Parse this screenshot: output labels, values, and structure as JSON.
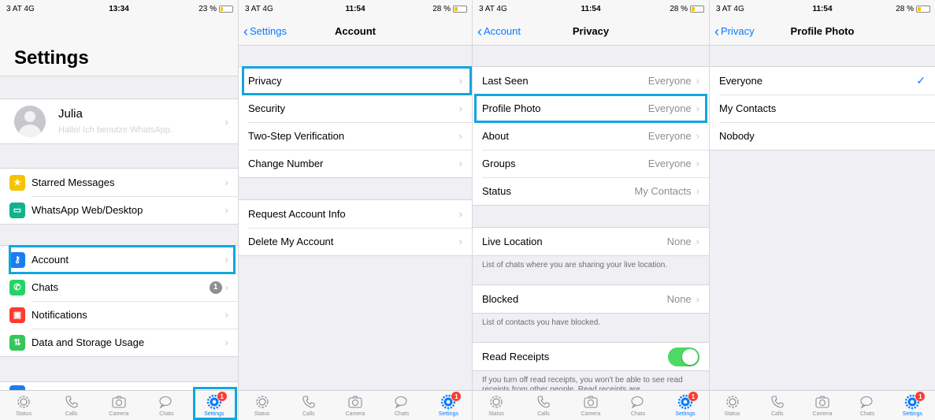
{
  "status": {
    "left": {
      "carrier": "3 AT 4G",
      "time": "13:34",
      "battery": "23 %",
      "battery_level": 0.23
    },
    "other": {
      "carrier": "3 AT 4G",
      "time": "11:54",
      "battery": "28 %",
      "battery_level": 0.28
    }
  },
  "tabs": [
    "Status",
    "Calls",
    "Camera",
    "Chats",
    "Settings"
  ],
  "tab_badge": "1",
  "settings": {
    "title": "Settings",
    "profile_name": "Julia",
    "profile_about": "Hallo! Ich benutze WhatsApp.",
    "items_a": [
      {
        "label": "Starred Messages",
        "color": "#f5c400",
        "glyph": "★"
      },
      {
        "label": "WhatsApp Web/Desktop",
        "color": "#12b28c",
        "glyph": "▭"
      }
    ],
    "items_b": [
      {
        "label": "Account",
        "color": "#1b7bf2",
        "glyph": "⚷"
      },
      {
        "label": "Chats",
        "color": "#25d366",
        "glyph": "✆",
        "badge": "1"
      },
      {
        "label": "Notifications",
        "color": "#ff3b30",
        "glyph": "▣"
      },
      {
        "label": "Data and Storage Usage",
        "color": "#34c759",
        "glyph": "⇅"
      }
    ]
  },
  "account": {
    "back": "Settings",
    "title": "Account",
    "items_a": [
      "Privacy",
      "Security",
      "Two-Step Verification",
      "Change Number"
    ],
    "items_b": [
      "Request Account Info",
      "Delete My Account"
    ]
  },
  "privacy": {
    "back": "Account",
    "title": "Privacy",
    "items": [
      {
        "label": "Last Seen",
        "value": "Everyone"
      },
      {
        "label": "Profile Photo",
        "value": "Everyone"
      },
      {
        "label": "About",
        "value": "Everyone"
      },
      {
        "label": "Groups",
        "value": "Everyone"
      },
      {
        "label": "Status",
        "value": "My Contacts"
      }
    ],
    "live_location": {
      "label": "Live Location",
      "value": "None"
    },
    "live_location_note": "List of chats where you are sharing your live location.",
    "blocked": {
      "label": "Blocked",
      "value": "None"
    },
    "blocked_note": "List of contacts you have blocked.",
    "read_receipts": {
      "label": "Read Receipts",
      "on": true
    },
    "read_receipts_note": "If you turn off read receipts, you won't be able to see read receipts from other people. Read receipts are"
  },
  "profile_photo": {
    "back": "Privacy",
    "title": "Profile Photo",
    "options": [
      "Everyone",
      "My Contacts",
      "Nobody"
    ],
    "selected": "Everyone"
  }
}
